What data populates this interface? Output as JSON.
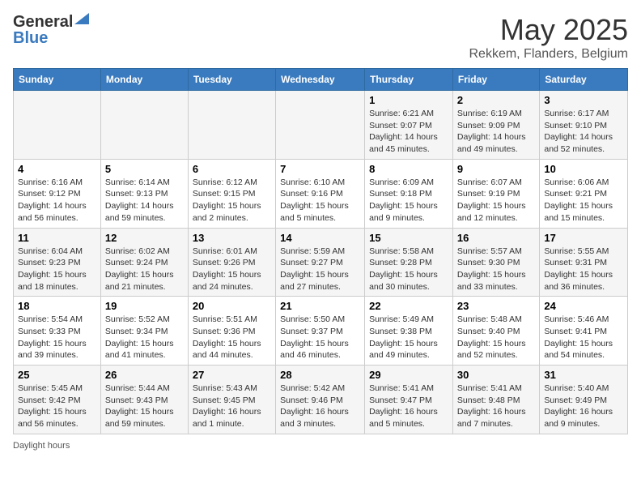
{
  "header": {
    "logo_general": "General",
    "logo_blue": "Blue",
    "title": "May 2025",
    "subtitle": "Rekkem, Flanders, Belgium"
  },
  "columns": [
    "Sunday",
    "Monday",
    "Tuesday",
    "Wednesday",
    "Thursday",
    "Friday",
    "Saturday"
  ],
  "weeks": [
    [
      {
        "day": "",
        "info": ""
      },
      {
        "day": "",
        "info": ""
      },
      {
        "day": "",
        "info": ""
      },
      {
        "day": "",
        "info": ""
      },
      {
        "day": "1",
        "info": "Sunrise: 6:21 AM\nSunset: 9:07 PM\nDaylight: 14 hours and 45 minutes."
      },
      {
        "day": "2",
        "info": "Sunrise: 6:19 AM\nSunset: 9:09 PM\nDaylight: 14 hours and 49 minutes."
      },
      {
        "day": "3",
        "info": "Sunrise: 6:17 AM\nSunset: 9:10 PM\nDaylight: 14 hours and 52 minutes."
      }
    ],
    [
      {
        "day": "4",
        "info": "Sunrise: 6:16 AM\nSunset: 9:12 PM\nDaylight: 14 hours and 56 minutes."
      },
      {
        "day": "5",
        "info": "Sunrise: 6:14 AM\nSunset: 9:13 PM\nDaylight: 14 hours and 59 minutes."
      },
      {
        "day": "6",
        "info": "Sunrise: 6:12 AM\nSunset: 9:15 PM\nDaylight: 15 hours and 2 minutes."
      },
      {
        "day": "7",
        "info": "Sunrise: 6:10 AM\nSunset: 9:16 PM\nDaylight: 15 hours and 5 minutes."
      },
      {
        "day": "8",
        "info": "Sunrise: 6:09 AM\nSunset: 9:18 PM\nDaylight: 15 hours and 9 minutes."
      },
      {
        "day": "9",
        "info": "Sunrise: 6:07 AM\nSunset: 9:19 PM\nDaylight: 15 hours and 12 minutes."
      },
      {
        "day": "10",
        "info": "Sunrise: 6:06 AM\nSunset: 9:21 PM\nDaylight: 15 hours and 15 minutes."
      }
    ],
    [
      {
        "day": "11",
        "info": "Sunrise: 6:04 AM\nSunset: 9:23 PM\nDaylight: 15 hours and 18 minutes."
      },
      {
        "day": "12",
        "info": "Sunrise: 6:02 AM\nSunset: 9:24 PM\nDaylight: 15 hours and 21 minutes."
      },
      {
        "day": "13",
        "info": "Sunrise: 6:01 AM\nSunset: 9:26 PM\nDaylight: 15 hours and 24 minutes."
      },
      {
        "day": "14",
        "info": "Sunrise: 5:59 AM\nSunset: 9:27 PM\nDaylight: 15 hours and 27 minutes."
      },
      {
        "day": "15",
        "info": "Sunrise: 5:58 AM\nSunset: 9:28 PM\nDaylight: 15 hours and 30 minutes."
      },
      {
        "day": "16",
        "info": "Sunrise: 5:57 AM\nSunset: 9:30 PM\nDaylight: 15 hours and 33 minutes."
      },
      {
        "day": "17",
        "info": "Sunrise: 5:55 AM\nSunset: 9:31 PM\nDaylight: 15 hours and 36 minutes."
      }
    ],
    [
      {
        "day": "18",
        "info": "Sunrise: 5:54 AM\nSunset: 9:33 PM\nDaylight: 15 hours and 39 minutes."
      },
      {
        "day": "19",
        "info": "Sunrise: 5:52 AM\nSunset: 9:34 PM\nDaylight: 15 hours and 41 minutes."
      },
      {
        "day": "20",
        "info": "Sunrise: 5:51 AM\nSunset: 9:36 PM\nDaylight: 15 hours and 44 minutes."
      },
      {
        "day": "21",
        "info": "Sunrise: 5:50 AM\nSunset: 9:37 PM\nDaylight: 15 hours and 46 minutes."
      },
      {
        "day": "22",
        "info": "Sunrise: 5:49 AM\nSunset: 9:38 PM\nDaylight: 15 hours and 49 minutes."
      },
      {
        "day": "23",
        "info": "Sunrise: 5:48 AM\nSunset: 9:40 PM\nDaylight: 15 hours and 52 minutes."
      },
      {
        "day": "24",
        "info": "Sunrise: 5:46 AM\nSunset: 9:41 PM\nDaylight: 15 hours and 54 minutes."
      }
    ],
    [
      {
        "day": "25",
        "info": "Sunrise: 5:45 AM\nSunset: 9:42 PM\nDaylight: 15 hours and 56 minutes."
      },
      {
        "day": "26",
        "info": "Sunrise: 5:44 AM\nSunset: 9:43 PM\nDaylight: 15 hours and 59 minutes."
      },
      {
        "day": "27",
        "info": "Sunrise: 5:43 AM\nSunset: 9:45 PM\nDaylight: 16 hours and 1 minute."
      },
      {
        "day": "28",
        "info": "Sunrise: 5:42 AM\nSunset: 9:46 PM\nDaylight: 16 hours and 3 minutes."
      },
      {
        "day": "29",
        "info": "Sunrise: 5:41 AM\nSunset: 9:47 PM\nDaylight: 16 hours and 5 minutes."
      },
      {
        "day": "30",
        "info": "Sunrise: 5:41 AM\nSunset: 9:48 PM\nDaylight: 16 hours and 7 minutes."
      },
      {
        "day": "31",
        "info": "Sunrise: 5:40 AM\nSunset: 9:49 PM\nDaylight: 16 hours and 9 minutes."
      }
    ]
  ],
  "footer": {
    "daylight_label": "Daylight hours"
  }
}
